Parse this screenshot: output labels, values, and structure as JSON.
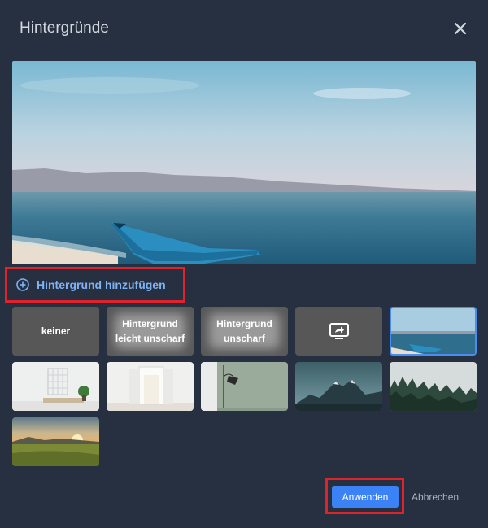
{
  "dialog": {
    "title": "Hintergründe",
    "close_icon": "close-icon",
    "add_background_label": "Hintergrund hinzufügen",
    "add_icon": "plus-circle-icon"
  },
  "tiles": {
    "none": "keiner",
    "light_blur_line1": "Hintergrund",
    "light_blur_line2": "leicht unscharf",
    "blur_line1": "Hintergrund",
    "blur_line2": "unscharf",
    "screen_share_icon": "screen-share-icon",
    "selected": "beach-boat"
  },
  "footer": {
    "apply_label": "Anwenden",
    "cancel_label": "Abbrechen"
  },
  "colors": {
    "dialog_bg": "#273041",
    "accent": "#3b82f6",
    "link": "#7fb2f3",
    "highlight": "#e0222b"
  }
}
